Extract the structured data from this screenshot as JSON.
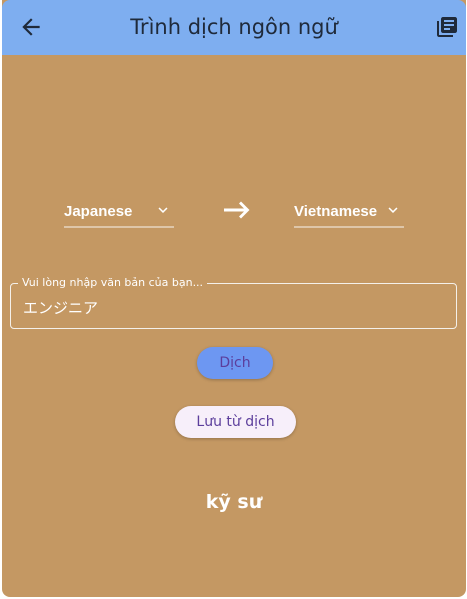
{
  "header": {
    "title": "Trình dịch ngôn ngữ",
    "back_icon": "arrow-left-icon",
    "history_icon": "library-books-icon"
  },
  "languages": {
    "source": "Japanese",
    "target": "Vietnamese",
    "dropdown_icon": "chevron-down-icon",
    "direction_icon": "arrow-right-icon"
  },
  "input": {
    "label": "Vui lòng nhập văn bản của bạn...",
    "value": "エンジニア"
  },
  "buttons": {
    "translate": "Dịch",
    "save": "Lưu từ dịch"
  },
  "result": {
    "text": "kỹ sư"
  },
  "colors": {
    "appbar": "#7eaef0",
    "background": "#c49863",
    "translate_button": "#6d97f2",
    "save_button": "#f7effa",
    "button_text": "#5c3e9c"
  }
}
